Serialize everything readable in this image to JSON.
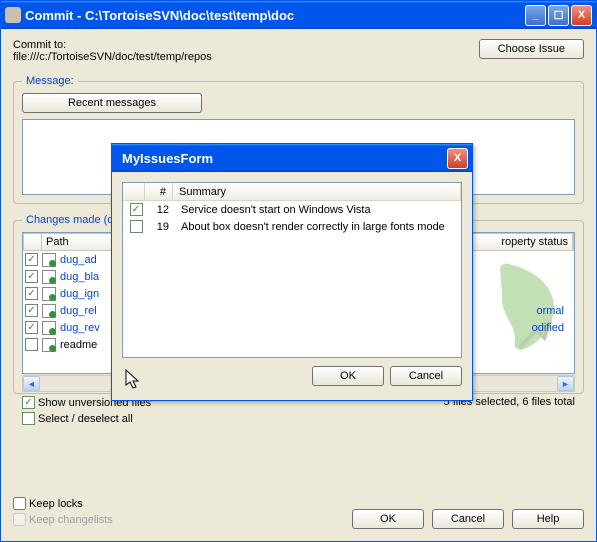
{
  "window": {
    "title": "Commit - C:\\TortoiseSVN\\doc\\test\\temp\\doc",
    "choose_issue": "Choose Issue",
    "commit_to_label": "Commit to:",
    "url": "file:///c:/TortoiseSVN/doc/test/temp/repos"
  },
  "message": {
    "legend": "Message:",
    "recent": "Recent messages"
  },
  "changes": {
    "legend": "Changes made (d",
    "col_path": "Path",
    "col_prop": "roperty status",
    "files": [
      {
        "checked": true,
        "name": "dug_ad",
        "status": ""
      },
      {
        "checked": true,
        "name": "dug_bla",
        "status": ""
      },
      {
        "checked": true,
        "name": "dug_ign",
        "status": ""
      },
      {
        "checked": true,
        "name": "dug_rel",
        "status": "ormal"
      },
      {
        "checked": true,
        "name": "dug_rev",
        "status": "odified"
      },
      {
        "checked": false,
        "name": "readme",
        "status": ""
      }
    ],
    "show_unversioned": "Show unversioned files",
    "select_deselect": "Select / deselect all",
    "status_text": "5 files selected, 6 files total"
  },
  "bottom": {
    "keep_locks": "Keep locks",
    "keep_changelists": "Keep changelists",
    "ok": "OK",
    "cancel": "Cancel",
    "help": "Help"
  },
  "dialog": {
    "title": "MyIssuesForm",
    "col_num": "#",
    "col_summary": "Summary",
    "rows": [
      {
        "checked": true,
        "num": "12",
        "summary": "Service doesn't start on Windows Vista"
      },
      {
        "checked": false,
        "num": "19",
        "summary": "About box doesn't render correctly in large fonts mode"
      }
    ],
    "ok": "OK",
    "cancel": "Cancel"
  }
}
